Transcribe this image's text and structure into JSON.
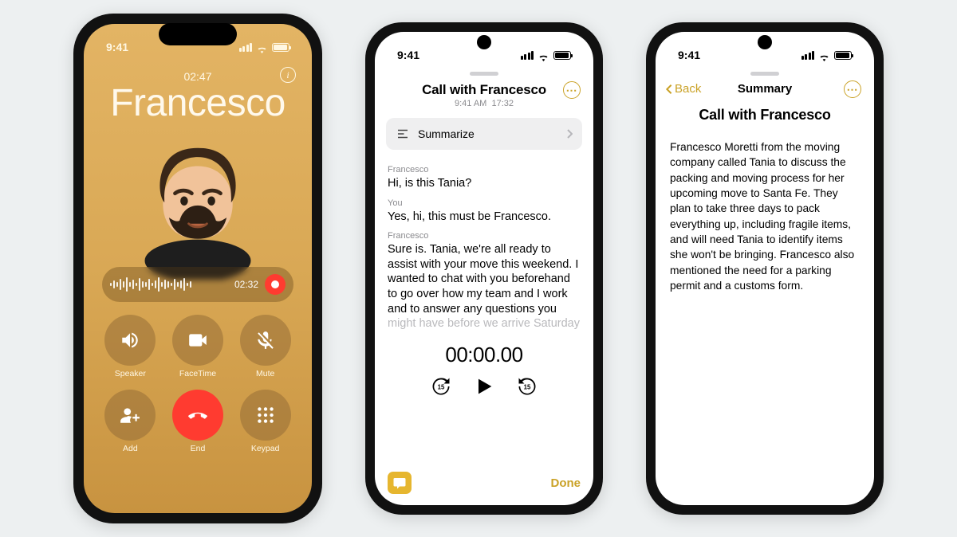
{
  "status_time": "9:41",
  "phone1": {
    "elapsed": "02:47",
    "caller_name": "Francesco",
    "recording_elapsed": "02:32",
    "buttons": {
      "speaker": "Speaker",
      "facetime": "FaceTime",
      "mute": "Mute",
      "add": "Add",
      "end": "End",
      "keypad": "Keypad"
    }
  },
  "phone2": {
    "title": "Call with Francesco",
    "timestamp": "9:41 AM",
    "duration": "17:32",
    "summarize_label": "Summarize",
    "transcript": [
      {
        "speaker": "Francesco",
        "text": "Hi, is this Tania?"
      },
      {
        "speaker": "You",
        "text": "Yes, hi, this must be Francesco."
      },
      {
        "speaker": "Francesco",
        "text": "Sure is. Tania, we're all ready to assist with your move this weekend. I wanted to chat with you beforehand to go over how my team and I work and to answer any questions you might have before we arrive Saturday"
      }
    ],
    "player_time": "00:00.00",
    "done_label": "Done"
  },
  "phone3": {
    "back_label": "Back",
    "header": "Summary",
    "title": "Call with Francesco",
    "body": "Francesco Moretti from the moving company called Tania to discuss the packing and moving process for her upcoming move to Santa Fe. They plan to take three days to pack everything up, including fragile items, and will need Tania to identify items she won't be bringing. Francesco also mentioned the need for a parking permit and a customs form."
  }
}
